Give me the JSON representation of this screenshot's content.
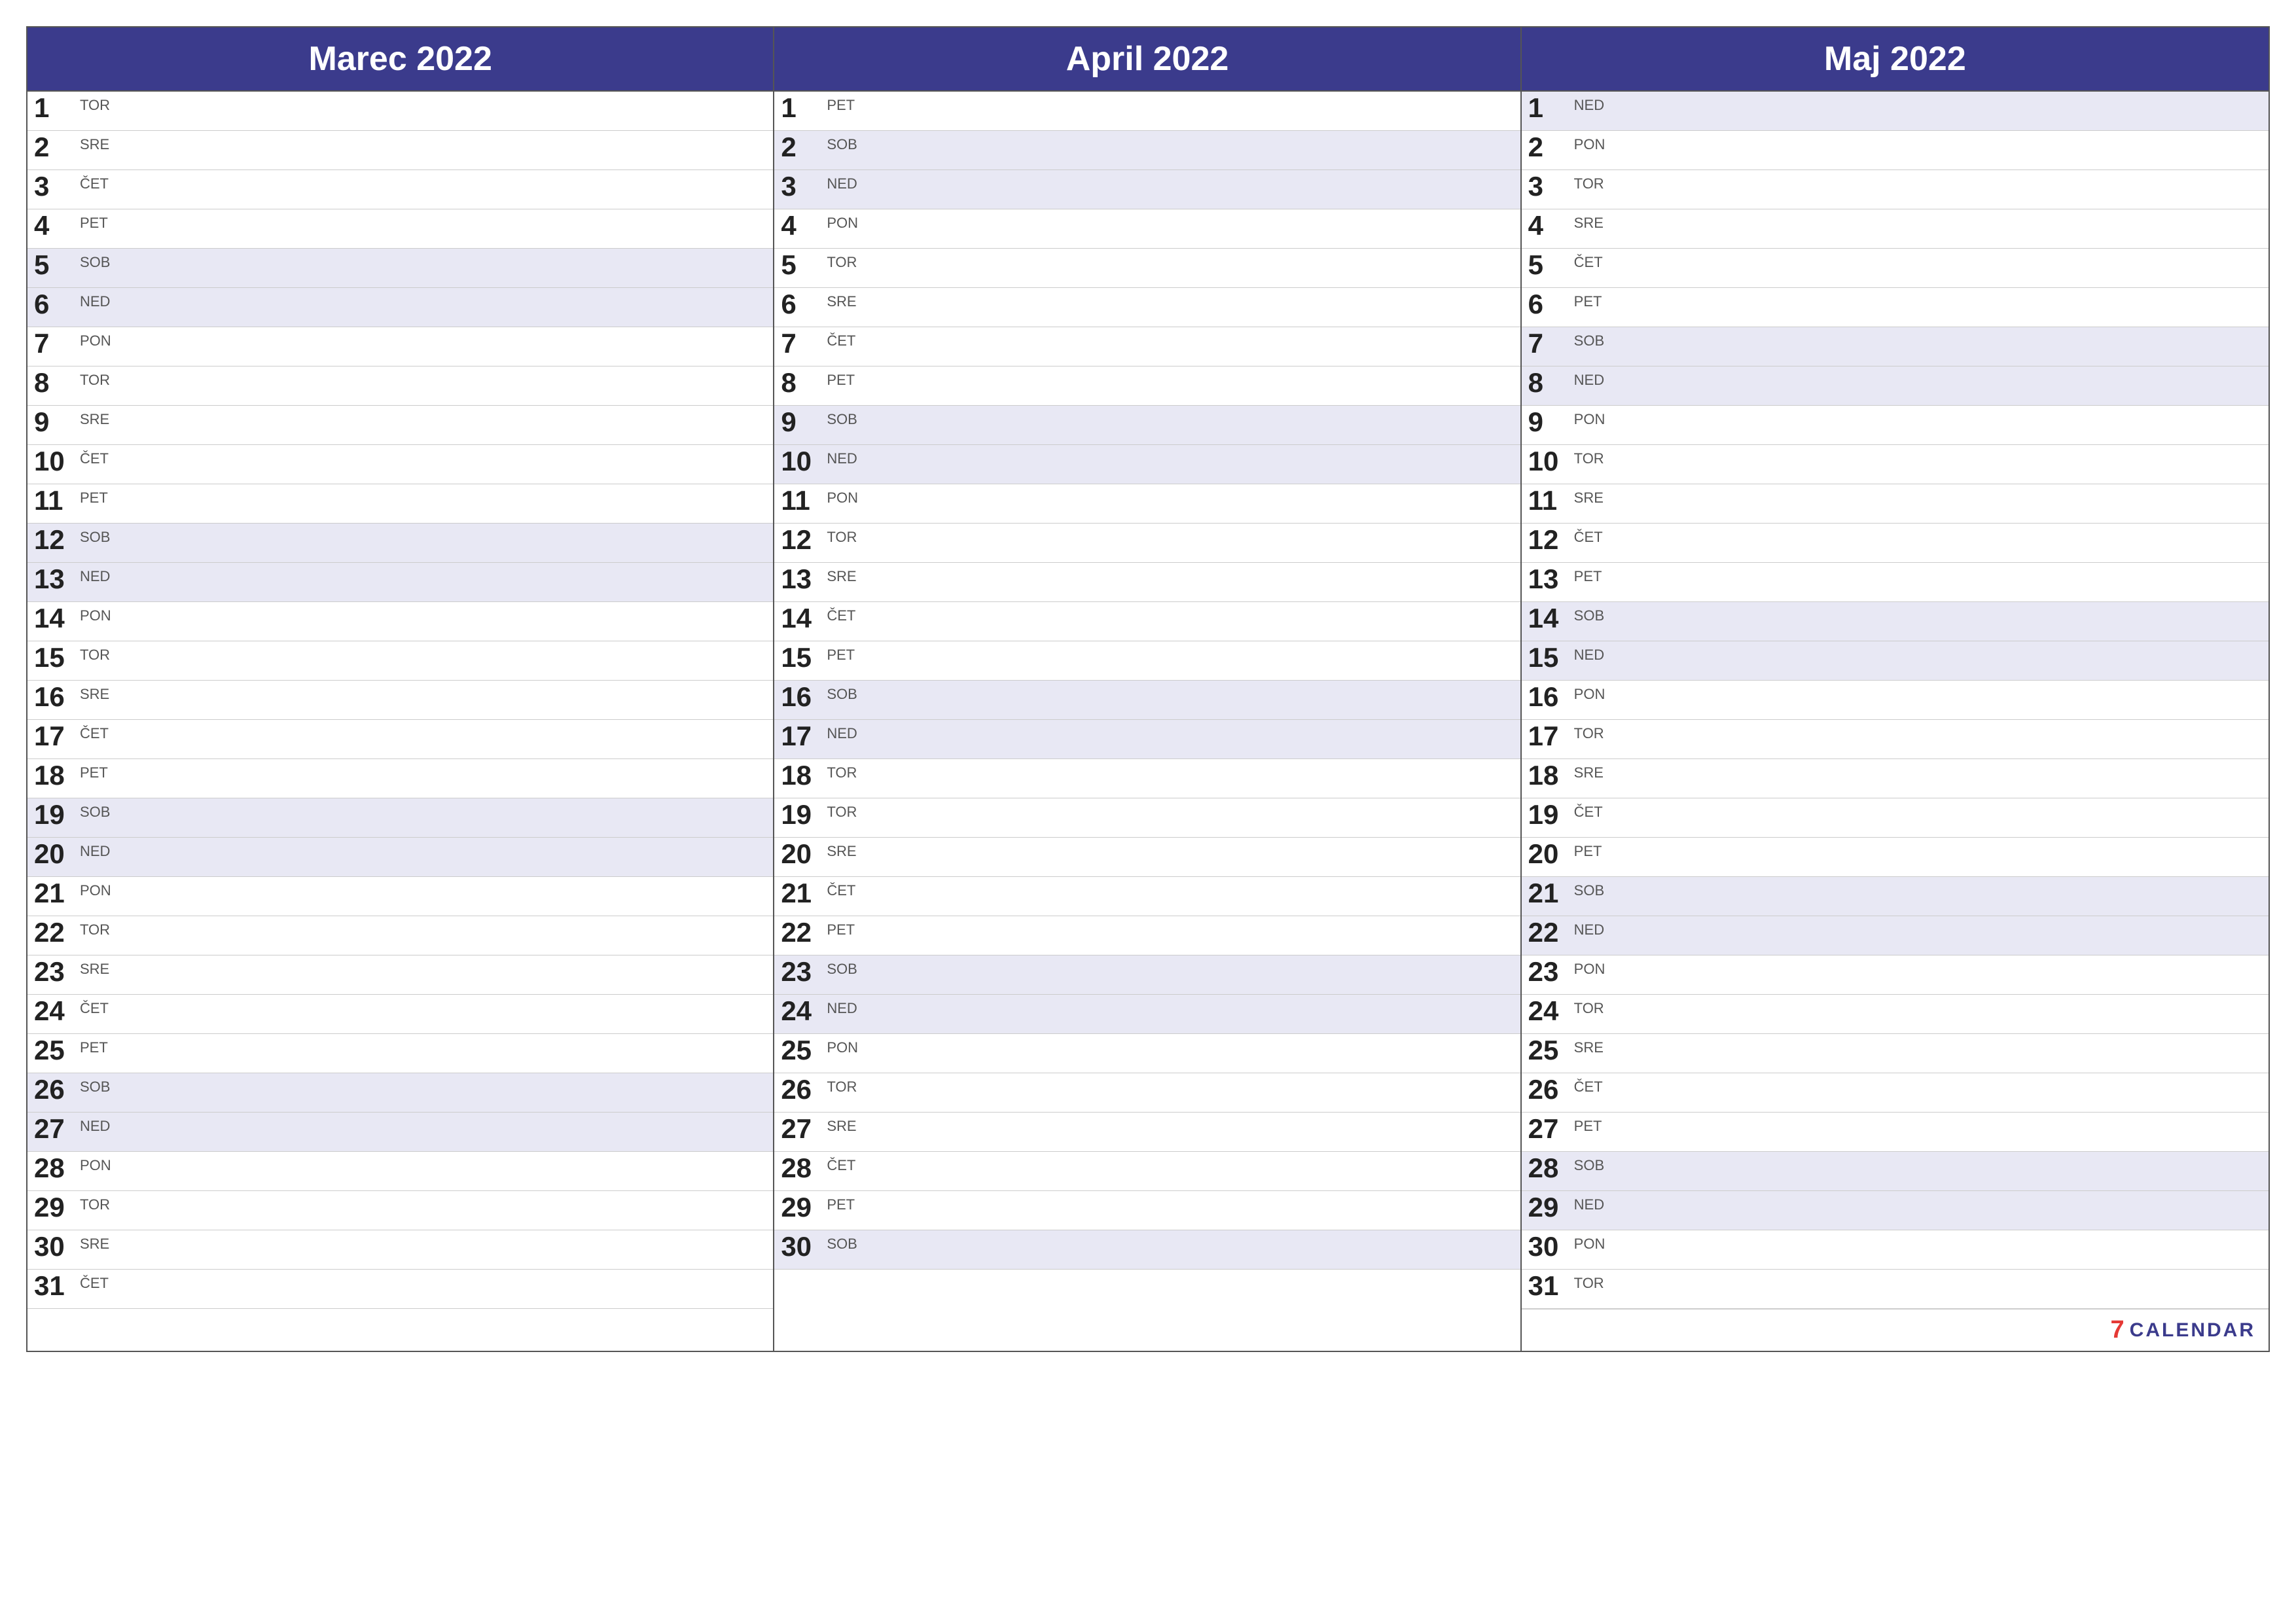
{
  "months": [
    {
      "id": "marec-2022",
      "title": "Marec 2022",
      "days": [
        {
          "num": "1",
          "name": "TOR",
          "weekend": false
        },
        {
          "num": "2",
          "name": "SRE",
          "weekend": false
        },
        {
          "num": "3",
          "name": "ČET",
          "weekend": false
        },
        {
          "num": "4",
          "name": "PET",
          "weekend": false
        },
        {
          "num": "5",
          "name": "SOB",
          "weekend": true
        },
        {
          "num": "6",
          "name": "NED",
          "weekend": true
        },
        {
          "num": "7",
          "name": "PON",
          "weekend": false
        },
        {
          "num": "8",
          "name": "TOR",
          "weekend": false
        },
        {
          "num": "9",
          "name": "SRE",
          "weekend": false
        },
        {
          "num": "10",
          "name": "ČET",
          "weekend": false
        },
        {
          "num": "11",
          "name": "PET",
          "weekend": false
        },
        {
          "num": "12",
          "name": "SOB",
          "weekend": true
        },
        {
          "num": "13",
          "name": "NED",
          "weekend": true
        },
        {
          "num": "14",
          "name": "PON",
          "weekend": false
        },
        {
          "num": "15",
          "name": "TOR",
          "weekend": false
        },
        {
          "num": "16",
          "name": "SRE",
          "weekend": false
        },
        {
          "num": "17",
          "name": "ČET",
          "weekend": false
        },
        {
          "num": "18",
          "name": "PET",
          "weekend": false
        },
        {
          "num": "19",
          "name": "SOB",
          "weekend": true
        },
        {
          "num": "20",
          "name": "NED",
          "weekend": true
        },
        {
          "num": "21",
          "name": "PON",
          "weekend": false
        },
        {
          "num": "22",
          "name": "TOR",
          "weekend": false
        },
        {
          "num": "23",
          "name": "SRE",
          "weekend": false
        },
        {
          "num": "24",
          "name": "ČET",
          "weekend": false
        },
        {
          "num": "25",
          "name": "PET",
          "weekend": false
        },
        {
          "num": "26",
          "name": "SOB",
          "weekend": true
        },
        {
          "num": "27",
          "name": "NED",
          "weekend": true
        },
        {
          "num": "28",
          "name": "PON",
          "weekend": false
        },
        {
          "num": "29",
          "name": "TOR",
          "weekend": false
        },
        {
          "num": "30",
          "name": "SRE",
          "weekend": false
        },
        {
          "num": "31",
          "name": "ČET",
          "weekend": false
        }
      ]
    },
    {
      "id": "april-2022",
      "title": "April 2022",
      "days": [
        {
          "num": "1",
          "name": "PET",
          "weekend": false
        },
        {
          "num": "2",
          "name": "SOB",
          "weekend": true
        },
        {
          "num": "3",
          "name": "NED",
          "weekend": true
        },
        {
          "num": "4",
          "name": "PON",
          "weekend": false
        },
        {
          "num": "5",
          "name": "TOR",
          "weekend": false
        },
        {
          "num": "6",
          "name": "SRE",
          "weekend": false
        },
        {
          "num": "7",
          "name": "ČET",
          "weekend": false
        },
        {
          "num": "8",
          "name": "PET",
          "weekend": false
        },
        {
          "num": "9",
          "name": "SOB",
          "weekend": true
        },
        {
          "num": "10",
          "name": "NED",
          "weekend": true
        },
        {
          "num": "11",
          "name": "PON",
          "weekend": false
        },
        {
          "num": "12",
          "name": "TOR",
          "weekend": false
        },
        {
          "num": "13",
          "name": "SRE",
          "weekend": false
        },
        {
          "num": "14",
          "name": "ČET",
          "weekend": false
        },
        {
          "num": "15",
          "name": "PET",
          "weekend": false
        },
        {
          "num": "16",
          "name": "SOB",
          "weekend": true
        },
        {
          "num": "17",
          "name": "NED",
          "weekend": true
        },
        {
          "num": "18",
          "name": "TOR",
          "weekend": false
        },
        {
          "num": "19",
          "name": "TOR",
          "weekend": false
        },
        {
          "num": "20",
          "name": "SRE",
          "weekend": false
        },
        {
          "num": "21",
          "name": "ČET",
          "weekend": false
        },
        {
          "num": "22",
          "name": "PET",
          "weekend": false
        },
        {
          "num": "23",
          "name": "SOB",
          "weekend": true
        },
        {
          "num": "24",
          "name": "NED",
          "weekend": true
        },
        {
          "num": "25",
          "name": "PON",
          "weekend": false
        },
        {
          "num": "26",
          "name": "TOR",
          "weekend": false
        },
        {
          "num": "27",
          "name": "SRE",
          "weekend": false
        },
        {
          "num": "28",
          "name": "ČET",
          "weekend": false
        },
        {
          "num": "29",
          "name": "PET",
          "weekend": false
        },
        {
          "num": "30",
          "name": "SOB",
          "weekend": true
        }
      ]
    },
    {
      "id": "maj-2022",
      "title": "Maj 2022",
      "days": [
        {
          "num": "1",
          "name": "NED",
          "weekend": true
        },
        {
          "num": "2",
          "name": "PON",
          "weekend": false
        },
        {
          "num": "3",
          "name": "TOR",
          "weekend": false
        },
        {
          "num": "4",
          "name": "SRE",
          "weekend": false
        },
        {
          "num": "5",
          "name": "ČET",
          "weekend": false
        },
        {
          "num": "6",
          "name": "PET",
          "weekend": false
        },
        {
          "num": "7",
          "name": "SOB",
          "weekend": true
        },
        {
          "num": "8",
          "name": "NED",
          "weekend": true
        },
        {
          "num": "9",
          "name": "PON",
          "weekend": false
        },
        {
          "num": "10",
          "name": "TOR",
          "weekend": false
        },
        {
          "num": "11",
          "name": "SRE",
          "weekend": false
        },
        {
          "num": "12",
          "name": "ČET",
          "weekend": false
        },
        {
          "num": "13",
          "name": "PET",
          "weekend": false
        },
        {
          "num": "14",
          "name": "SOB",
          "weekend": true
        },
        {
          "num": "15",
          "name": "NED",
          "weekend": true
        },
        {
          "num": "16",
          "name": "PON",
          "weekend": false
        },
        {
          "num": "17",
          "name": "TOR",
          "weekend": false
        },
        {
          "num": "18",
          "name": "SRE",
          "weekend": false
        },
        {
          "num": "19",
          "name": "ČET",
          "weekend": false
        },
        {
          "num": "20",
          "name": "PET",
          "weekend": false
        },
        {
          "num": "21",
          "name": "SOB",
          "weekend": true
        },
        {
          "num": "22",
          "name": "NED",
          "weekend": true
        },
        {
          "num": "23",
          "name": "PON",
          "weekend": false
        },
        {
          "num": "24",
          "name": "TOR",
          "weekend": false
        },
        {
          "num": "25",
          "name": "SRE",
          "weekend": false
        },
        {
          "num": "26",
          "name": "ČET",
          "weekend": false
        },
        {
          "num": "27",
          "name": "PET",
          "weekend": false
        },
        {
          "num": "28",
          "name": "SOB",
          "weekend": true
        },
        {
          "num": "29",
          "name": "NED",
          "weekend": true
        },
        {
          "num": "30",
          "name": "PON",
          "weekend": false
        },
        {
          "num": "31",
          "name": "TOR",
          "weekend": false
        }
      ]
    }
  ],
  "logo": {
    "seven": "7",
    "text": "CALENDAR"
  }
}
